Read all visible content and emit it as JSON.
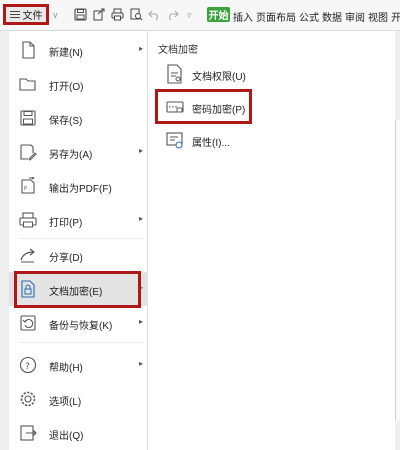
{
  "toolbar": {
    "file_label": "文件",
    "tabs": [
      "开始",
      "插入",
      "页面布局",
      "公式",
      "数据",
      "审阅",
      "视图",
      "开"
    ]
  },
  "menu": {
    "items": [
      {
        "label": "新建(N)",
        "icon": "new-document-icon"
      },
      {
        "label": "打开(O)",
        "icon": "open-folder-icon"
      },
      {
        "label": "保存(S)",
        "icon": "save-icon"
      },
      {
        "label": "另存为(A)",
        "icon": "save-as-icon"
      },
      {
        "label": "输出为PDF(F)",
        "icon": "export-pdf-icon"
      },
      {
        "label": "打印(P)",
        "icon": "print-icon"
      },
      {
        "label": "分享(D)",
        "icon": "share-icon"
      },
      {
        "label": "文档加密(E)",
        "icon": "document-encrypt-icon"
      },
      {
        "label": "备份与恢复(K)",
        "icon": "backup-restore-icon"
      },
      {
        "label": "帮助(H)",
        "icon": "help-icon"
      },
      {
        "label": "选项(L)",
        "icon": "options-gear-icon"
      },
      {
        "label": "退出(Q)",
        "icon": "exit-icon"
      }
    ]
  },
  "submenu": {
    "title": "文档加密",
    "items": [
      {
        "label": "文档权限(U)",
        "icon": "document-permission-icon"
      },
      {
        "label": "密码加密(P)",
        "icon": "password-encrypt-icon"
      },
      {
        "label": "属性(I)...",
        "icon": "properties-icon"
      }
    ]
  },
  "colors": {
    "accent_green": "#39a33c",
    "highlight_red": "#b01818"
  }
}
